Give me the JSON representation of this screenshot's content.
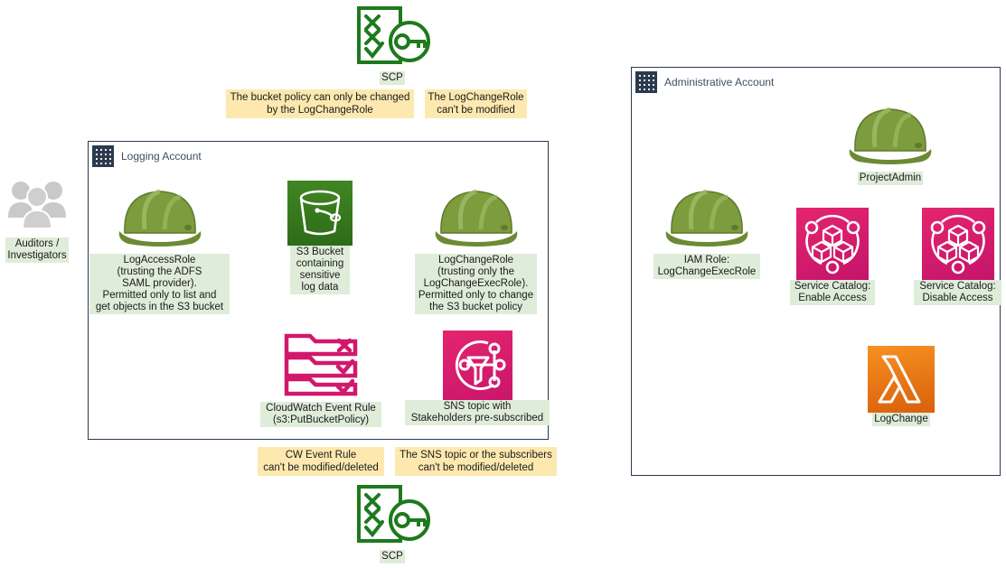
{
  "diagram": {
    "title": "AWS Logging / Administrative Account Protection Diagram",
    "colors": {
      "account_border": "#2b3a4e",
      "caption_bg": "#dfecd9",
      "note_bg": "#fde9b0",
      "s3_green": "#3f8624",
      "sns_pink": "#e5256f",
      "service_catalog_pink": "#c4146a",
      "lambda_orange": "#f79021",
      "scp_green": "#1d7a1d",
      "hardhat_green": "#7a9b3f",
      "people_gray": "#bdbdbd"
    }
  },
  "actors": {
    "auditors": {
      "label": "Auditors /\nInvestigators",
      "icon": "people-group-icon"
    }
  },
  "scp_top": {
    "label": "SCP",
    "icon": "scp-policy-key-icon"
  },
  "scp_bottom": {
    "label": "SCP",
    "icon": "scp-policy-key-icon"
  },
  "notes": {
    "bucket_policy": "The bucket policy can only be changed\nby the LogChangeRole",
    "logchangerole": "The LogChangeRole\ncan't be modified",
    "cw_event_rule": "CW Event Rule\ncan't be modified/deleted",
    "sns_topic": "The SNS topic or the subscribers\ncan't be modified/deleted"
  },
  "logging_account": {
    "title": "Logging Account",
    "icon": "aws-account-icon",
    "nodes": [
      {
        "name": "log-access-role",
        "icon": "hard-hat-icon",
        "label": "LogAccessRole\n(trusting the ADFS\nSAML provider).\nPermitted only to list and\nget objects in the S3 bucket"
      },
      {
        "name": "s3-bucket",
        "icon": "s3-bucket-icon",
        "label": "S3 Bucket\ncontaining\nsensitive\nlog data"
      },
      {
        "name": "log-change-role",
        "icon": "hard-hat-icon",
        "label": "LogChangeRole\n(trusting only the\nLogChangeExecRole).\nPermitted only to change\nthe S3 bucket policy"
      },
      {
        "name": "cloudwatch-event-rule",
        "icon": "cloudwatch-event-rule-icon",
        "label": "CloudWatch Event Rule\n(s3:PutBucketPolicy)"
      },
      {
        "name": "sns-topic",
        "icon": "sns-topic-icon",
        "label": "SNS topic with\nStakeholders pre-subscribed"
      }
    ]
  },
  "administrative_account": {
    "title": "Administrative Account",
    "icon": "aws-account-icon",
    "nodes": [
      {
        "name": "project-admin",
        "icon": "hard-hat-icon",
        "label": "ProjectAdmin"
      },
      {
        "name": "log-change-exec-role",
        "icon": "hard-hat-icon",
        "label": "IAM Role:\nLogChangeExecRole"
      },
      {
        "name": "service-catalog-enable",
        "icon": "service-catalog-icon",
        "label": "Service Catalog:\nEnable Access"
      },
      {
        "name": "service-catalog-disable",
        "icon": "service-catalog-icon",
        "label": "Service Catalog:\nDisable Access"
      },
      {
        "name": "lambda-log-change",
        "icon": "lambda-icon",
        "label": "LogChange"
      }
    ]
  }
}
